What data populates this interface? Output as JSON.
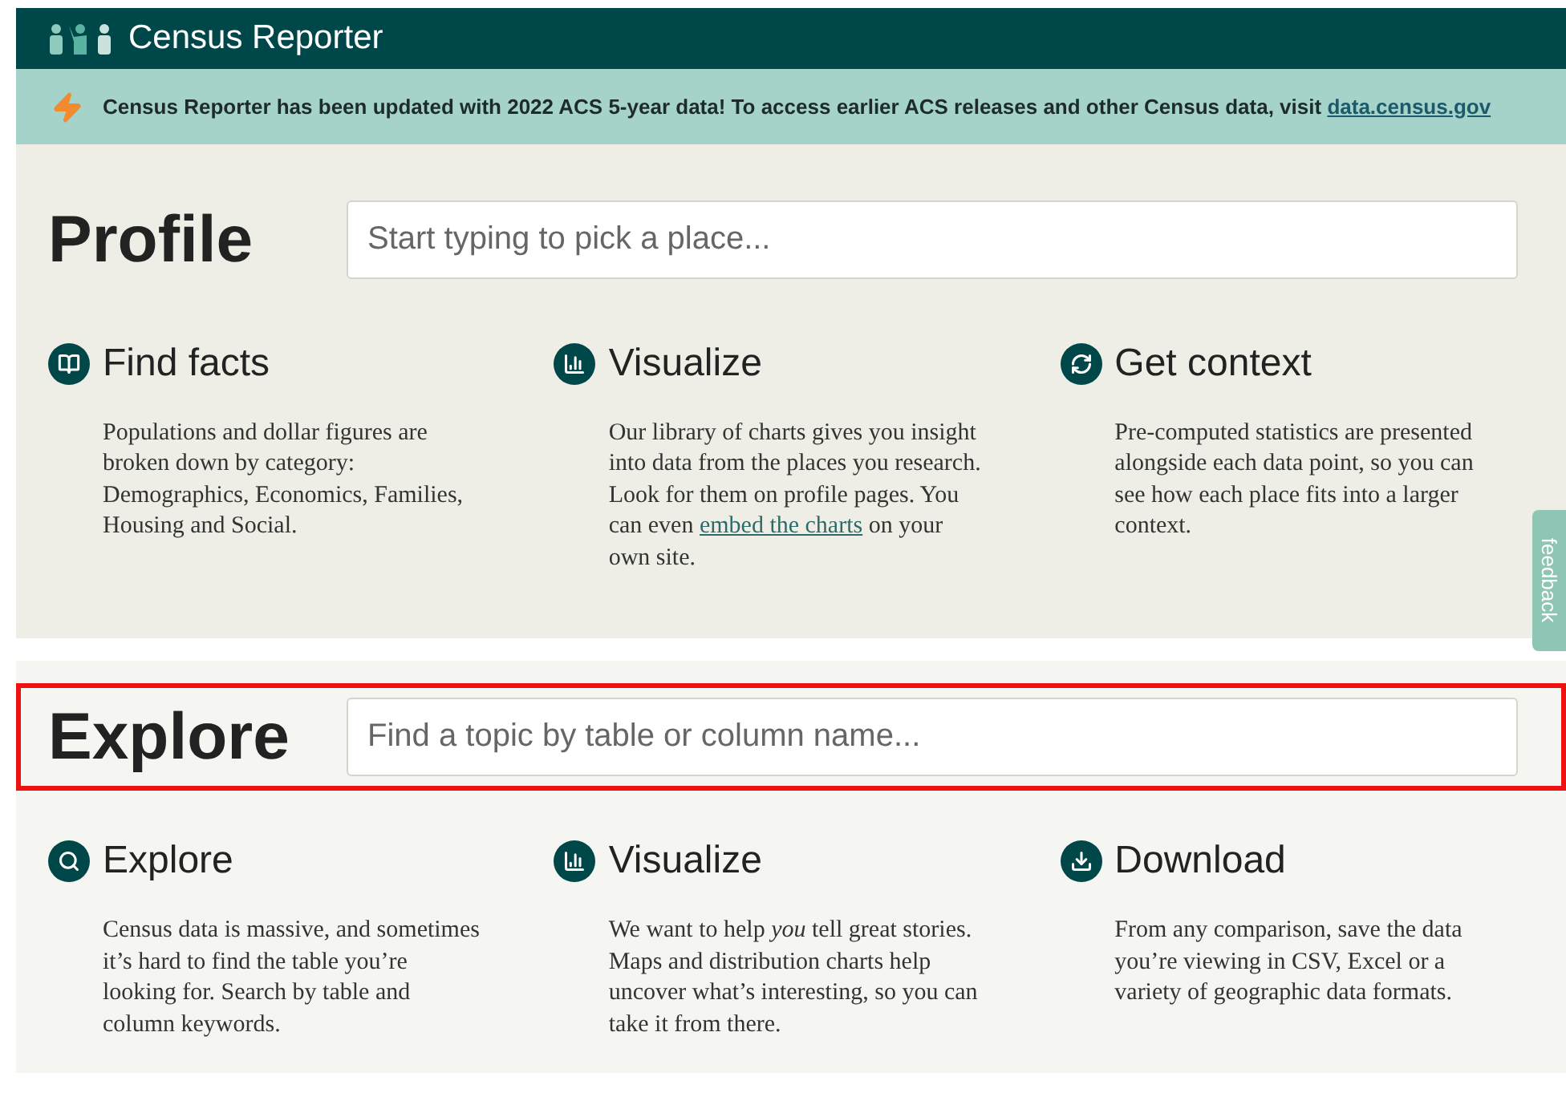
{
  "header": {
    "title": "Census Reporter"
  },
  "banner": {
    "text": "Census Reporter has been updated with 2022 ACS 5-year data! To access earlier ACS releases and other Census data, visit",
    "link": "data.census.gov"
  },
  "sections": [
    {
      "title": "Profile",
      "placeholder": "Start typing to pick a place...",
      "highlighted": false,
      "features": [
        {
          "kind": "book",
          "heading": "Find facts",
          "body": "Populations and dollar figures are broken down by category: Demographics, Economics, Families, Housing and Social."
        },
        {
          "kind": "chart",
          "heading": "Visualize",
          "body": "Our library of charts gives you insight into data from the places you research. Look for them on profile pages. You can even",
          "link": "embed the charts",
          "after": "on your own site."
        },
        {
          "kind": "refresh",
          "heading": "Get context",
          "body": "Pre-computed statistics are presented alongside each data point, so you can see how each place fits into a larger context."
        }
      ]
    },
    {
      "title": "Explore",
      "placeholder": "Find a topic by table or column name...",
      "highlighted": true,
      "features": [
        {
          "kind": "search",
          "heading": "Explore",
          "body": "Census data is massive, and sometimes it’s hard to find the table you’re looking for. Search by table and column keywords."
        },
        {
          "kind": "chart",
          "heading": "Visualize",
          "body": "We want to help *you* tell great stories. Maps and distribution charts help uncover what’s interesting, so you can take it from there."
        },
        {
          "kind": "download",
          "heading": "Download",
          "body": "From any comparison, save the data you’re viewing in CSV, Excel or a variety of geographic data formats."
        }
      ]
    }
  ],
  "feedback": "feedback"
}
